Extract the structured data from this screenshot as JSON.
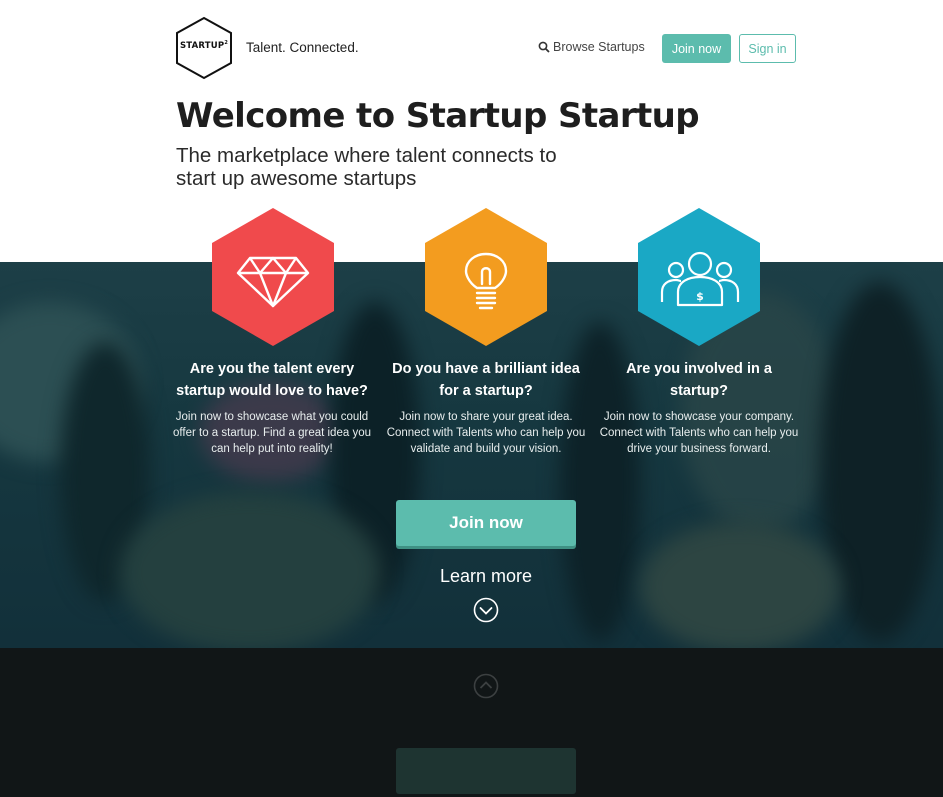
{
  "header": {
    "logo_text": "STARTUP",
    "logo_sup": "2",
    "tagline": "Talent. Connected.",
    "nav": {
      "browse_label": "Browse Startups",
      "browse_icon": "search-icon",
      "join_label": "Join now",
      "signin_label": "Sign in"
    }
  },
  "hero": {
    "title": "Welcome to Startup Startup",
    "subtitle": "The marketplace where talent connects to start up awesome startups"
  },
  "features": [
    {
      "icon": "diamond-icon",
      "color": "#f04a4c",
      "title": "Are you the talent every startup would love to have?",
      "desc": "Join now to showcase what you could offer to a startup. Find a great idea you can help put into reality!"
    },
    {
      "icon": "lightbulb-icon",
      "color": "#f39c1f",
      "title": "Do you have a brilliant idea for a startup?",
      "desc": "Join now to share your great idea. Connect with Talents who can help you validate and build your vision."
    },
    {
      "icon": "team-icon",
      "color": "#1aa8c5",
      "title": "Are you involved in a startup?",
      "desc": "Join now to showcase your company. Connect with Talents who can help you drive your business forward."
    }
  ],
  "cta": {
    "join_label": "Join now",
    "learn_more": "Learn more"
  },
  "colors": {
    "accent": "#5cbcad",
    "dark": "#1e1e1e"
  }
}
